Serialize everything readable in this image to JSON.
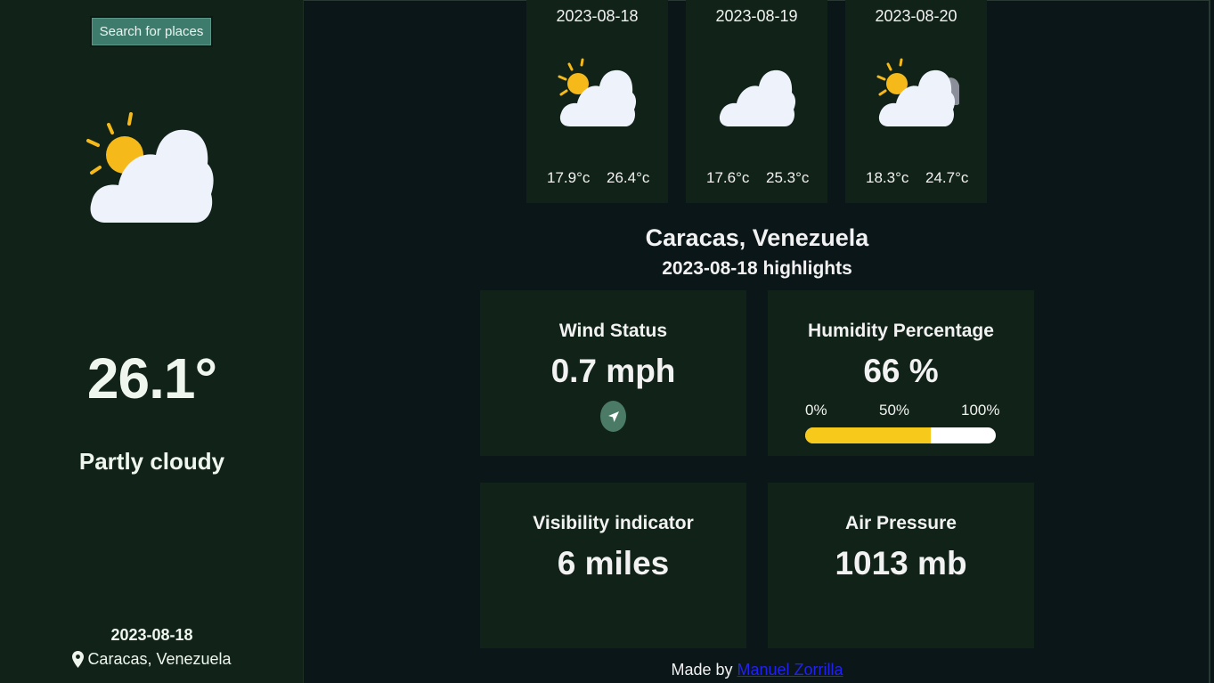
{
  "sidebar": {
    "search_label": "Search for places",
    "icon": "partly-cloudy-icon",
    "temperature": "26.1°",
    "condition": "Partly cloudy",
    "date": "2023-08-18",
    "location": "Caracas, Venezuela",
    "location_icon": "map-pin-icon"
  },
  "forecast": [
    {
      "date": "2023-08-18",
      "icon": "partly-cloudy-icon",
      "min": "17.9°c",
      "max": "26.4°c"
    },
    {
      "date": "2023-08-19",
      "icon": "cloud-icon",
      "min": "17.6°c",
      "max": "25.3°c"
    },
    {
      "date": "2023-08-20",
      "icon": "partly-cloudy-overcast-icon",
      "min": "18.3°c",
      "max": "24.7°c"
    }
  ],
  "main": {
    "city": "Caracas, Venezuela",
    "highlights_title": "2023-08-18 highlights"
  },
  "highlights": {
    "wind": {
      "label": "Wind Status",
      "value": "0.7 mph",
      "icon": "navigation-arrow-icon"
    },
    "humidity": {
      "label": "Humidity Percentage",
      "value": "66 %",
      "percent": 66,
      "scale": [
        "0%",
        "50%",
        "100%"
      ]
    },
    "visibility": {
      "label": "Visibility indicator",
      "value": "6 miles"
    },
    "pressure": {
      "label": "Air Pressure",
      "value": "1013 mb"
    }
  },
  "footer": {
    "prefix": "Made by ",
    "author": "Manuel Zorrilla"
  },
  "colors": {
    "sidebar_bg": "#112318",
    "page_bg": "#0b1619",
    "button": "#3d7c6c",
    "humidity_fill": "#f7c91b",
    "link": "#2222ee"
  }
}
